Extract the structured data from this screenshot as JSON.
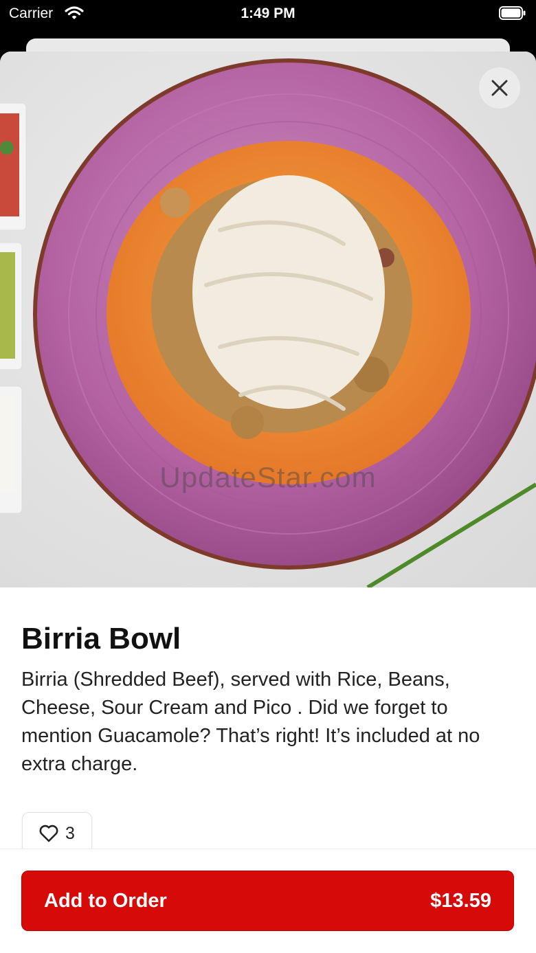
{
  "status_bar": {
    "carrier": "Carrier",
    "time": "1:49 PM",
    "wifi_icon": "wifi-icon",
    "battery_icon": "battery-icon"
  },
  "hero": {
    "watermark": "UpdateStar.com",
    "close_icon": "close-icon"
  },
  "item": {
    "title": "Birria Bowl",
    "description": "Birria (Shredded Beef), served with Rice, Beans, Cheese, Sour Cream and Pico . Did we forget to mention Guacamole? That’s right! It’s included at no extra charge.",
    "likes": "3"
  },
  "order": {
    "label": "Add to Order",
    "price": "$13.59"
  },
  "colors": {
    "accent": "#d70a0a",
    "plate": "#b968a6"
  }
}
